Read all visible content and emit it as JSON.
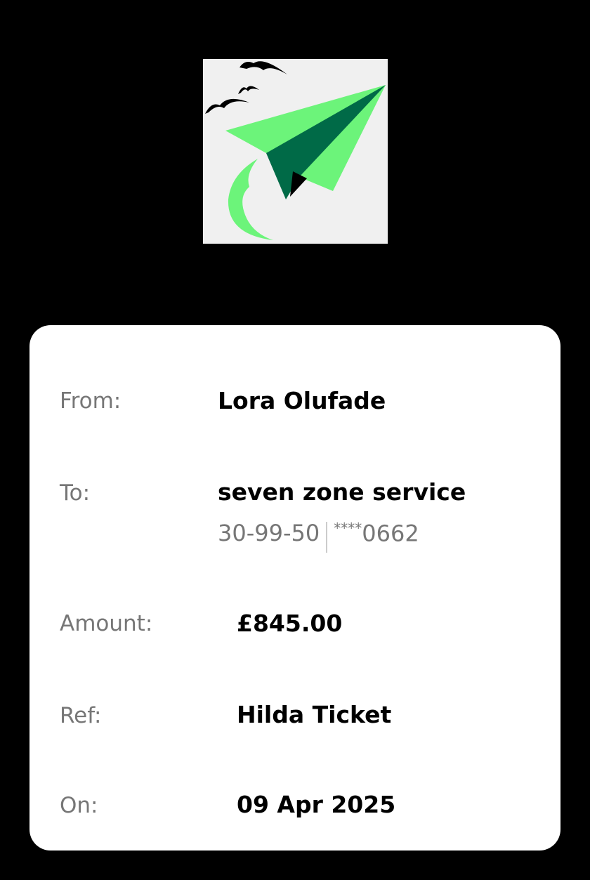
{
  "logo": {
    "icon": "paper-plane-with-birds-logo",
    "colors": {
      "background": "#f0f0f0",
      "plane_light": "#6cf47a",
      "plane_dark": "#006a47",
      "birds": "#000000"
    }
  },
  "payment": {
    "from_label": "From:",
    "from_value": "Lora Olufade",
    "to_label": "To:",
    "to_value": "seven zone service",
    "sort_code": "30-99-50",
    "account_mask": "****",
    "account_last4": "0662",
    "amount_label": "Amount:",
    "amount_value": "£845.00",
    "ref_label": "Ref:",
    "ref_value": "Hilda Ticket",
    "on_label": "On:",
    "on_value": "09 Apr 2025"
  }
}
